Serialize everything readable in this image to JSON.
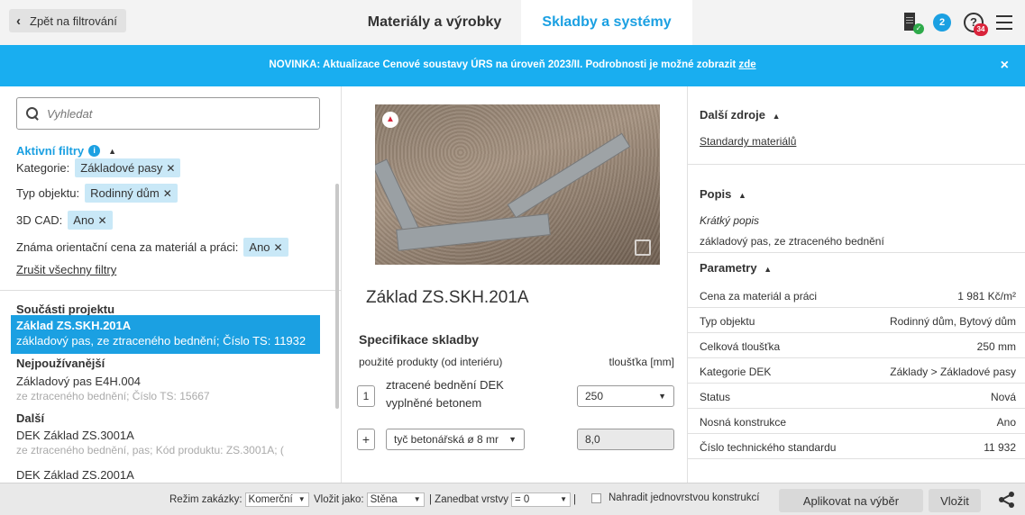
{
  "header": {
    "back_label": "Zpět na filtrování",
    "tabs": [
      {
        "label": "Materiály a výrobky",
        "active": false
      },
      {
        "label": "Skladby a systémy",
        "active": true
      }
    ],
    "notifications_count": "2",
    "help_badge": "34",
    "icons": [
      "building-check-icon",
      "notification-badge",
      "help-icon",
      "hamburger-menu-icon"
    ]
  },
  "banner": {
    "text": "NOVINKA: Aktualizace Cenové soustavy ÚRS na úroveň 2023/II.  Podrobnosti je možné zobrazit",
    "link": "zde",
    "close": "×"
  },
  "left": {
    "search_placeholder": "Vyhledat",
    "active_filters_label": "Aktivní filtry",
    "filters": [
      {
        "label": "Kategorie:",
        "value": "Základové pasy"
      },
      {
        "label": "Typ objektu:",
        "value": "Rodinný dům"
      },
      {
        "label": "3D CAD:",
        "value": "Ano"
      },
      {
        "label": "Známa orientační cena za materiál a práci:",
        "value": "Ano"
      }
    ],
    "clear_all": "Zrušit všechny filtry",
    "section_project": "Součásti projektu",
    "selected": {
      "title": "Základ ZS.SKH.201A",
      "subtitle": "základový pas, ze ztraceného bednění; Číslo TS: 11932"
    },
    "section_most_used": "Nejpoužívanější",
    "most_used": [
      {
        "title": "Základový pas E4H.004",
        "subtitle": "ze ztraceného bednění; Číslo TS: 15667"
      }
    ],
    "section_other": "Další",
    "other": [
      {
        "title": "DEK Základ ZS.3001A",
        "subtitle": "ze ztraceného bednění, pas; Kód produktu: ZS.3001A; ("
      },
      {
        "title": "DEK Základ ZS.2001A",
        "subtitle": ""
      }
    ]
  },
  "middle": {
    "product_title": "Základ ZS.SKH.201A",
    "spec_title": "Specifikace skladby",
    "spec_sub": "použité produkty (od interiéru)",
    "spec_thickness_header": "tloušťka [mm]",
    "layer_number": "1",
    "layer_name": "ztracené bednění DEK vyplněné betonem",
    "layer_thickness": "250",
    "add_symbol": "+",
    "rebar_select": "tyč betonářská ø 8 mr",
    "rebar_value": "8,0"
  },
  "right": {
    "resources_title": "Další zdroje",
    "resources_link": "Standardy materiálů",
    "desc_title": "Popis",
    "short_desc_label": "Krátký popis",
    "short_desc": "základový pas, ze ztraceného bednění",
    "params_title": "Parametry",
    "params": [
      {
        "key": "Cena za materiál a práci",
        "value": "1 981 Kč/m²"
      },
      {
        "key": "Typ objektu",
        "value": "Rodinný dům, Bytový dům"
      },
      {
        "key": "Celková tloušťka",
        "value": "250 mm"
      },
      {
        "key": "Kategorie DEK",
        "value": "Základy > Základové pasy"
      },
      {
        "key": "Status",
        "value": "Nová"
      },
      {
        "key": "Nosná konstrukce",
        "value": "Ano"
      },
      {
        "key": "Číslo technického standardu",
        "value": "11 932"
      }
    ]
  },
  "bottom": {
    "mode_label": "Režim zakázky:",
    "mode_value": "Komerční",
    "insert_as_label": "Vložit jako:",
    "insert_as_value": "Stěna",
    "neglect_label": "| Zanedbat vrstvy",
    "neglect_value": "= 0",
    "pipe": "|",
    "replace_label": "Nahradit jednovrstvou konstrukcí",
    "apply_button": "Aplikovat na výběr",
    "insert_button": "Vložit"
  },
  "colors": {
    "accent": "#1ba0e2",
    "banner": "#19aef0",
    "chip": "#c9e8f7",
    "alert_red": "#d9243b",
    "ok_green": "#2eaa4a"
  }
}
